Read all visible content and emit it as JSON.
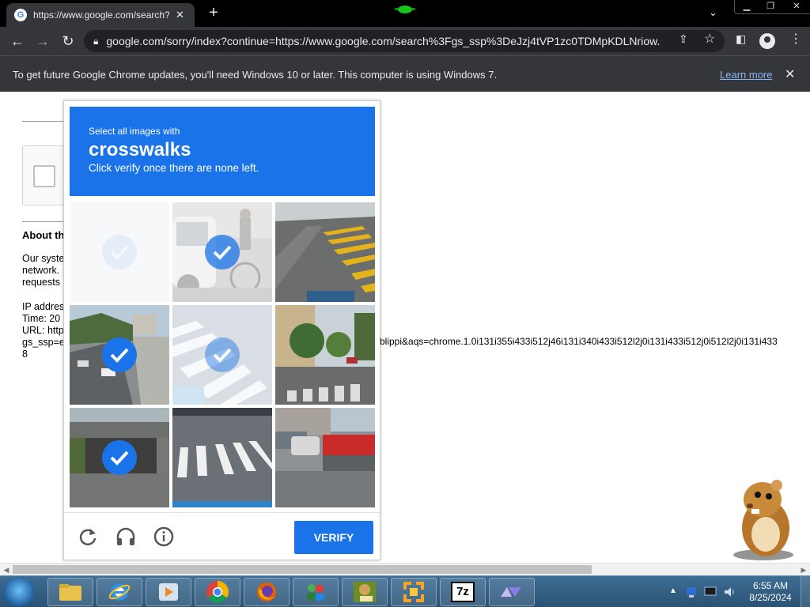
{
  "browser": {
    "tab_title": "https://www.google.com/search?",
    "url_display": "google.com/sorry/index?continue=https://www.google.com/search%3Fgs_ssp%3DeJzj4tVP1zc0TDMpKDLNriow..."
  },
  "infobar": {
    "message": "To get future Google Chrome updates, you'll need Windows 10 or later. This computer is using Windows 7.",
    "link_label": "Learn more"
  },
  "page": {
    "about_heading": "About th",
    "body_lines": [
      "Our syste",
      "network.",
      "requests"
    ],
    "ip_label": "IP addres",
    "time_label": "Time: 20",
    "url_label": "URL: http",
    "gs_label": "gs_ssp=e",
    "tail_label": "8",
    "overflow_url": "blippi&aqs=chrome.1.0i131i355i433i512j46i131i340i433i512l2j0i131i433i512j0i512l2j0i131i433"
  },
  "challenge": {
    "instruction_small": "Select all images with",
    "target": "crosswalks",
    "instruction_sub": "Click verify once there are none left.",
    "verify_label": "VERIFY",
    "tiles": [
      {
        "state": "loading"
      },
      {
        "state": "selected-faded"
      },
      {
        "state": "unselected"
      },
      {
        "state": "selected"
      },
      {
        "state": "selected-faded"
      },
      {
        "state": "unselected"
      },
      {
        "state": "selected"
      },
      {
        "state": "unselected"
      },
      {
        "state": "unselected"
      }
    ],
    "icons": [
      "reload-icon",
      "audio-icon",
      "info-icon"
    ]
  },
  "taskbar": {
    "apps": [
      "file-explorer",
      "internet-explorer",
      "media-player",
      "chrome",
      "firefox",
      "users-app",
      "sandbox-app",
      "arrows-app",
      "7zip",
      "vector-app"
    ],
    "sevenzip_label": "7z",
    "time": "6:55 AM",
    "date": "8/25/2024"
  },
  "colors": {
    "accent": "#1a73e8",
    "chrome_dark": "#35363a",
    "link": "#8ab4f8"
  }
}
